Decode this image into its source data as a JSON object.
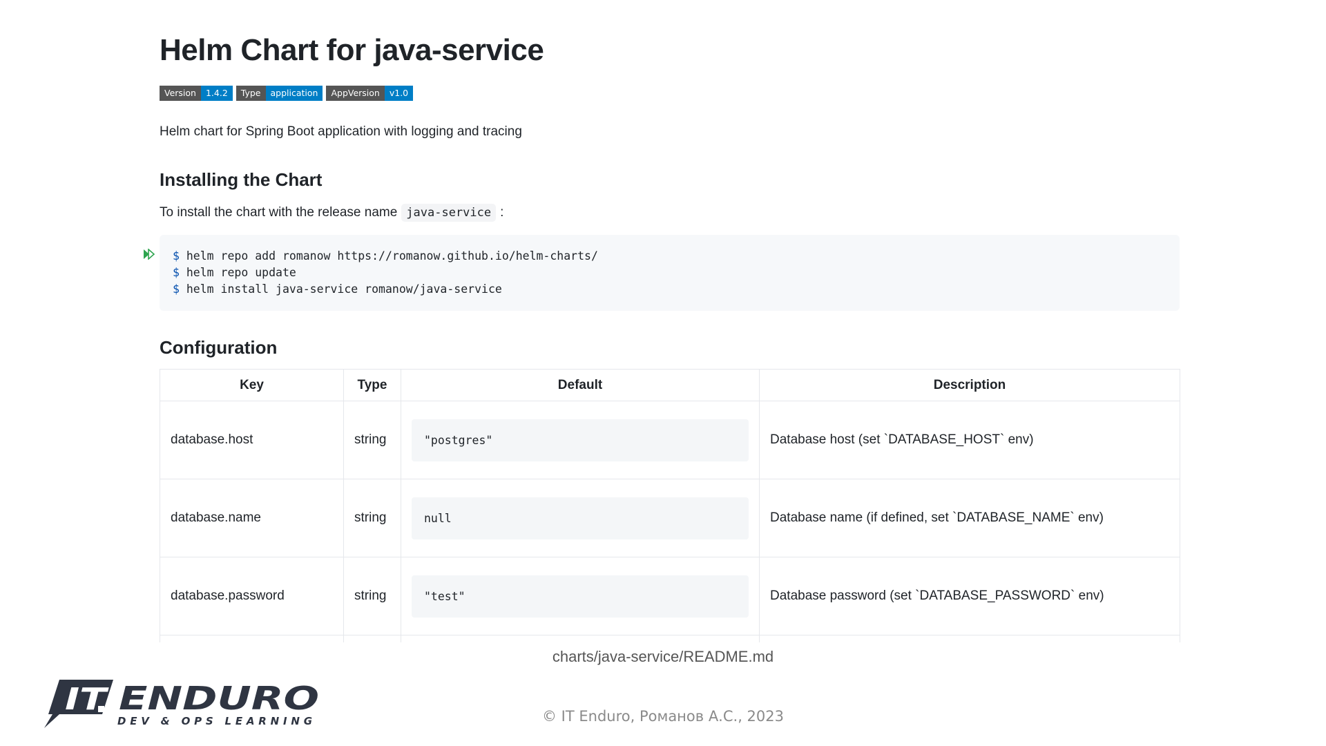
{
  "readme": {
    "title": "Helm Chart for java-service",
    "badges": [
      {
        "label": "Version",
        "value": "1.4.2"
      },
      {
        "label": "Type",
        "value": "application"
      },
      {
        "label": "AppVersion",
        "value": "v1.0"
      }
    ],
    "description": "Helm chart for Spring Boot application with logging and tracing",
    "install_heading": "Installing the Chart",
    "install_text_before": "To install the chart with the release name",
    "install_code": "java-service",
    "install_text_after": ":",
    "code_prompt": "$",
    "code_lines": [
      "helm repo add romanow https://romanow.github.io/helm-charts/",
      "helm repo update",
      "helm install java-service romanow/java-service"
    ],
    "config_heading": "Configuration",
    "table": {
      "headers": [
        "Key",
        "Type",
        "Default",
        "Description"
      ],
      "rows": [
        {
          "key": "database.host",
          "type": "string",
          "default": "\"postgres\"",
          "description": "Database host (set `DATABASE_HOST` env)"
        },
        {
          "key": "database.name",
          "type": "string",
          "default": "null",
          "description": "Database name (if defined, set `DATABASE_NAME` env)"
        },
        {
          "key": "database.password",
          "type": "string",
          "default": "\"test\"",
          "description": "Database password (set `DATABASE_PASSWORD` env)"
        }
      ]
    }
  },
  "caption": "charts/java-service/README.md",
  "footer": {
    "copyright": "© IT Enduro, Романов А.С., 2023",
    "logo_main": "IT ENDURO",
    "logo_sub": "DEV & OPS LEARNING"
  },
  "colors": {
    "badge_label": "#555555",
    "badge_value": "#007ec6",
    "code_bg": "#f6f8fa",
    "run_icon": "#2da44e",
    "logo": "#2f3542"
  },
  "icons": {
    "run": "run-icon"
  }
}
